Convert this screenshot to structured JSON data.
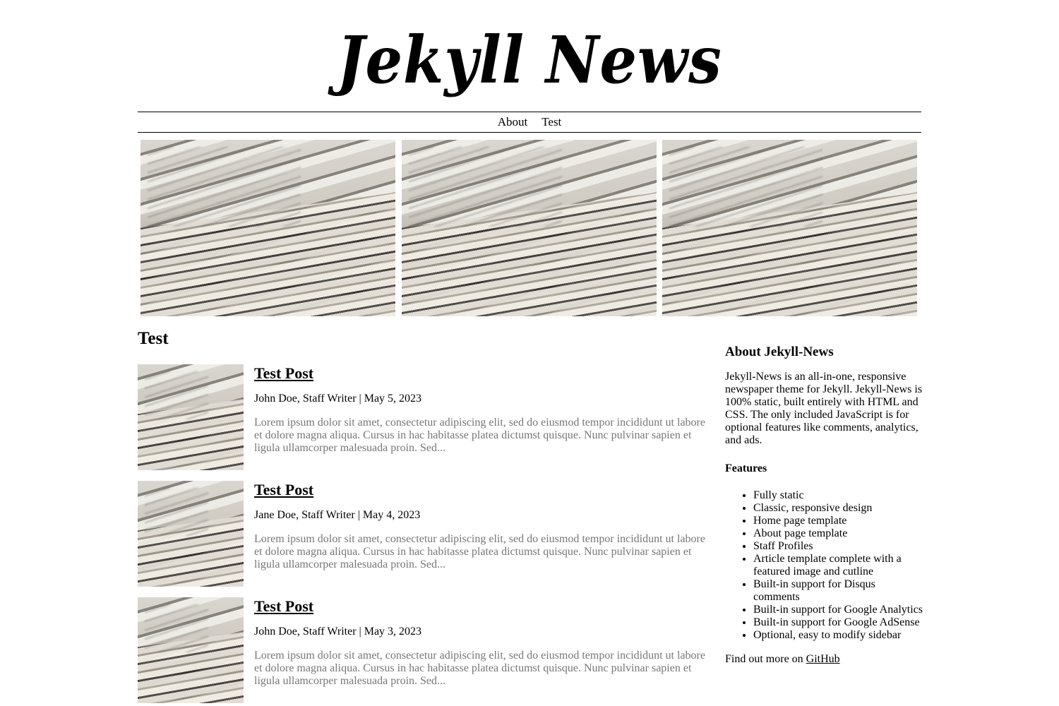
{
  "site": {
    "title": "Jekyll News"
  },
  "nav": {
    "items": [
      "About",
      "Test"
    ]
  },
  "section": {
    "title": "Test"
  },
  "posts": [
    {
      "title": "Test Post",
      "byline": "John Doe, Staff Writer | May 5, 2023",
      "excerpt": "Lorem ipsum dolor sit amet, consectetur adipiscing elit, sed do eiusmod tempor incididunt ut labore et dolore magna aliqua. Cursus in hac habitasse platea dictumst quisque. Nunc pulvinar sapien et ligula ullamcorper malesuada proin. Sed..."
    },
    {
      "title": "Test Post",
      "byline": "Jane Doe, Staff Writer | May 4, 2023",
      "excerpt": "Lorem ipsum dolor sit amet, consectetur adipiscing elit, sed do eiusmod tempor incididunt ut labore et dolore magna aliqua. Cursus in hac habitasse platea dictumst quisque. Nunc pulvinar sapien et ligula ullamcorper malesuada proin. Sed..."
    },
    {
      "title": "Test Post",
      "byline": "John Doe, Staff Writer | May 3, 2023",
      "excerpt": "Lorem ipsum dolor sit amet, consectetur adipiscing elit, sed do eiusmod tempor incididunt ut labore et dolore magna aliqua. Cursus in hac habitasse platea dictumst quisque. Nunc pulvinar sapien et ligula ullamcorper malesuada proin. Sed..."
    }
  ],
  "sidebar": {
    "heading": "About Jekyll-News",
    "intro": "Jekyll-News is an all-in-one, responsive newspaper theme for Jekyll. Jekyll-News is 100% static, built entirely with HTML and CSS. The only included JavaScript is for optional features like comments, analytics, and ads.",
    "features_heading": "Features",
    "features": [
      "Fully static",
      "Classic, responsive design",
      "Home page template",
      "About page template",
      "Staff Profiles",
      "Article template complete with a featured image and cutline",
      "Built-in support for Disqus comments",
      "Built-in support for Google Analytics",
      "Built-in support for Google AdSense",
      "Optional, easy to modify sidebar"
    ],
    "footer_text": "Find out more on",
    "footer_link": "GitHub"
  },
  "colors": {
    "text": "#000000",
    "excerpt": "#777777",
    "background": "#ffffff"
  },
  "icons": {
    "hero_image": "newspaper-stack-photo",
    "thumbnail": "newspaper-stack-photo"
  }
}
